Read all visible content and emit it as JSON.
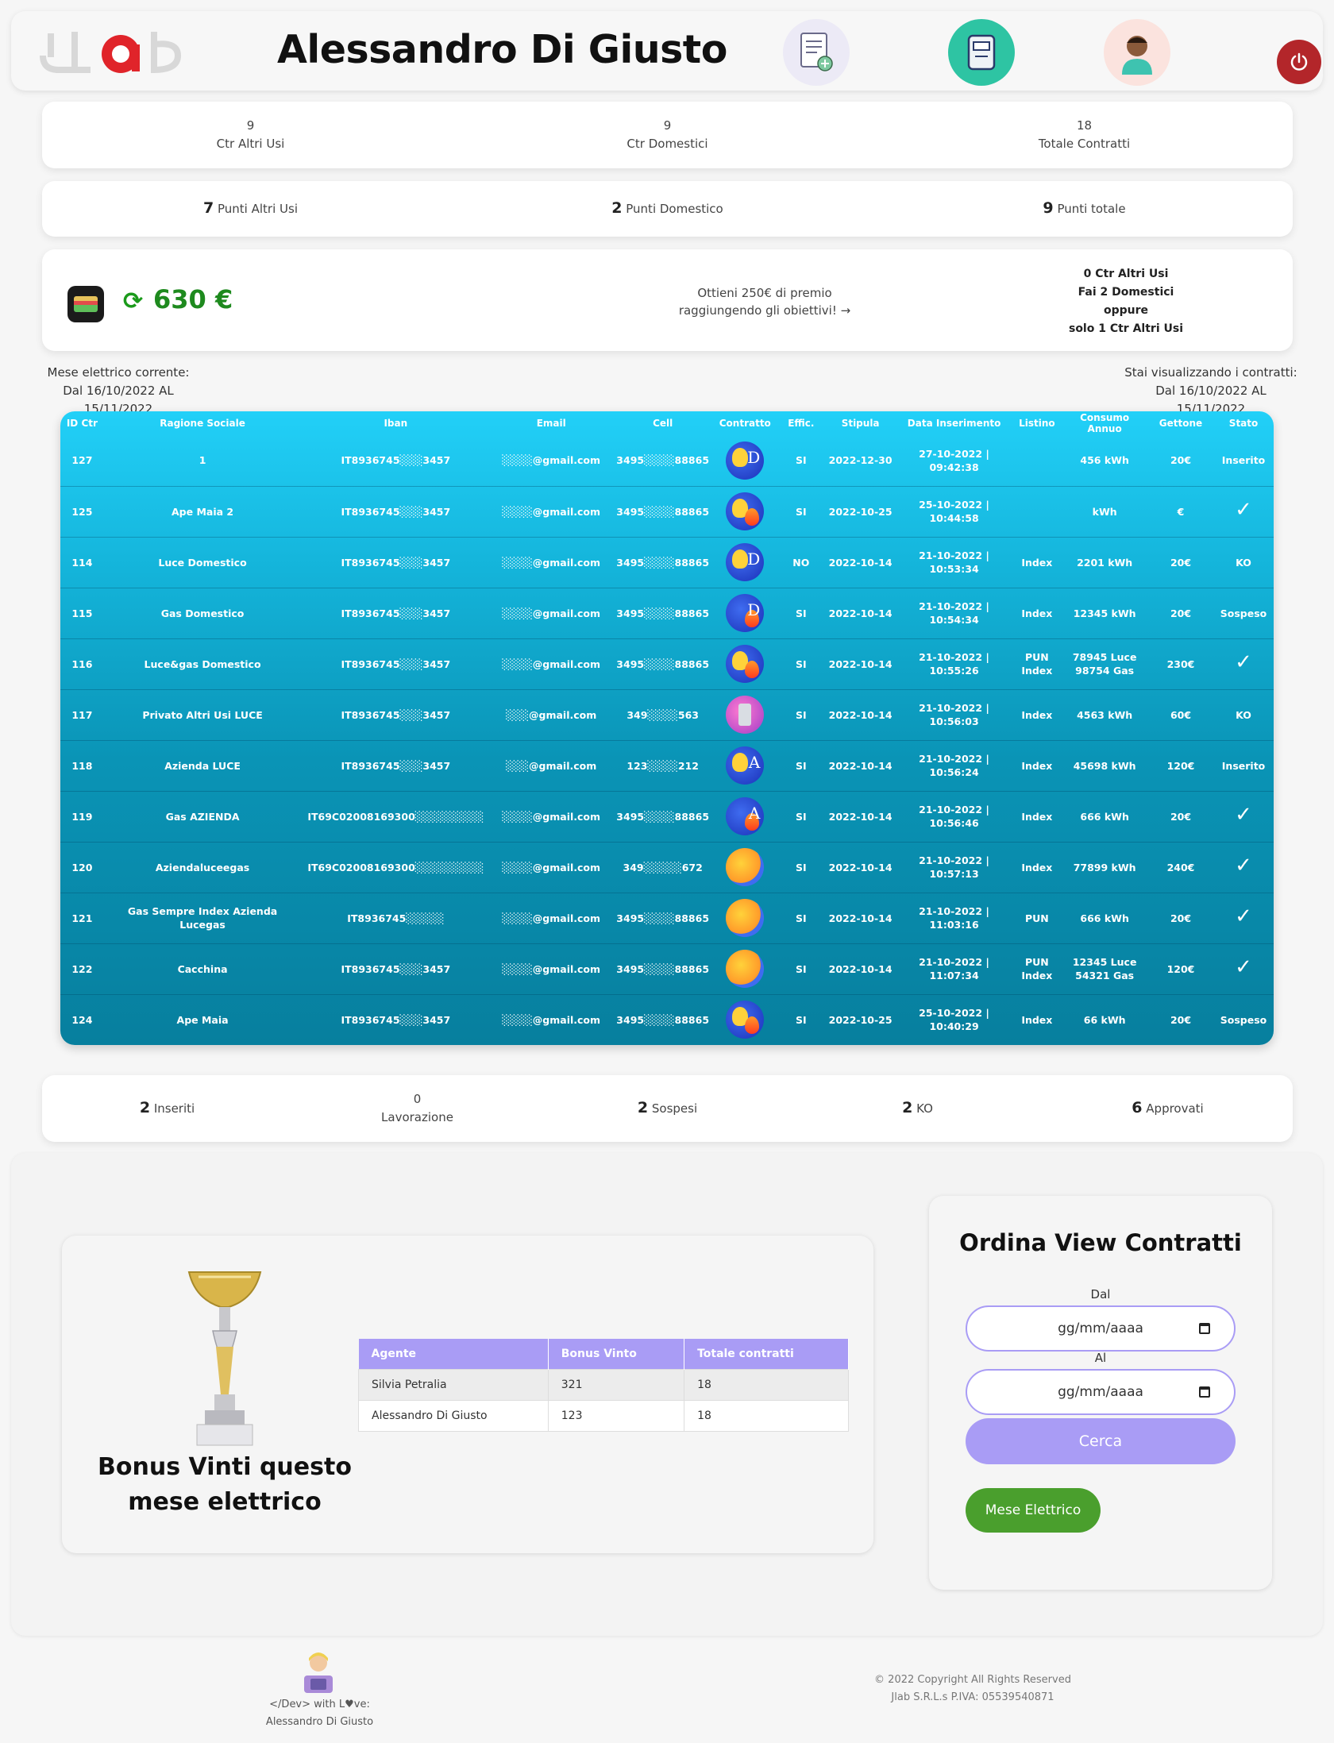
{
  "header": {
    "logo_text": "JLab",
    "agent_name": "Alessandro Di Giusto"
  },
  "counts": {
    "altri_usi_value": "9",
    "altri_usi_label": "Ctr Altri Usi",
    "domestici_value": "9",
    "domestici_label": "Ctr Domestici",
    "totale_value": "18",
    "totale_label": "Totale Contratti"
  },
  "points": {
    "altri_usi_value": "7",
    "altri_usi_label": "Punti Altri Usi",
    "domestico_value": "2",
    "domestico_label": "Punti Domestico",
    "totale_value": "9",
    "totale_label": "Punti totale"
  },
  "wallet": {
    "amount": "630 €",
    "promo_line1": "Ottieni 250€ di premio",
    "promo_line2": "raggiungendo gli obiettivi! →",
    "goal_1": "0 Ctr Altri Usi",
    "goal_2": "Fai 2 Domestici",
    "goal_3": "oppure",
    "goal_4": "solo 1 Ctr Altri Usi"
  },
  "period": {
    "left_line1": "Mese elettrico corrente:",
    "left_line2": "Dal 16/10/2022 AL 15/11/2022",
    "right_line1": "Stai visualizzando i contratti:",
    "right_line2": "Dal 16/10/2022 AL 15/11/2022"
  },
  "contracts": {
    "columns": [
      "ID Ctr",
      "Ragione Sociale",
      "Iban",
      "Email",
      "Cell",
      "Contratto",
      "Effic.",
      "Stipula",
      "Data Inserimento",
      "Listino",
      "Consumo Annuo",
      "Gettone",
      "Stato"
    ],
    "rows": [
      {
        "id": "127",
        "ragione": "1",
        "iban": "IT8936745░░░3457",
        "email": "░░░░@gmail.com",
        "cell": "3495░░░░88865",
        "contratto": "luce-D",
        "effic": "SI",
        "stipula": "2022-12-30",
        "data": "27-10-2022 | 09:42:38",
        "listino": "",
        "consumo": "456 kWh",
        "gettone": "20€",
        "stato": "Inserito"
      },
      {
        "id": "125",
        "ragione": "Ape Maia 2",
        "iban": "IT8936745░░░3457",
        "email": "░░░░@gmail.com",
        "cell": "3495░░░░88865",
        "contratto": "dual",
        "effic": "SI",
        "stipula": "2022-10-25",
        "data": "25-10-2022 | 10:44:58",
        "listino": "",
        "consumo": "kWh",
        "gettone": "€",
        "stato": "✓"
      },
      {
        "id": "114",
        "ragione": "Luce Domestico",
        "iban": "IT8936745░░░3457",
        "email": "░░░░@gmail.com",
        "cell": "3495░░░░88865",
        "contratto": "luce-D",
        "effic": "NO",
        "stipula": "2022-10-14",
        "data": "21-10-2022 | 10:53:34",
        "listino": "Index",
        "consumo": "2201 kWh",
        "gettone": "20€",
        "stato": "KO"
      },
      {
        "id": "115",
        "ragione": "Gas Domestico",
        "iban": "IT8936745░░░3457",
        "email": "░░░░@gmail.com",
        "cell": "3495░░░░88865",
        "contratto": "gas-D",
        "effic": "SI",
        "stipula": "2022-10-14",
        "data": "21-10-2022 | 10:54:34",
        "listino": "Index",
        "consumo": "12345 kWh",
        "gettone": "20€",
        "stato": "Sospeso"
      },
      {
        "id": "116",
        "ragione": "Luce&gas Domestico",
        "iban": "IT8936745░░░3457",
        "email": "░░░░@gmail.com",
        "cell": "3495░░░░88865",
        "contratto": "dual",
        "effic": "SI",
        "stipula": "2022-10-14",
        "data": "21-10-2022 | 10:55:26",
        "listino": "PUN\nIndex",
        "consumo": "78945 Luce\n98754 Gas",
        "gettone": "230€",
        "stato": "✓"
      },
      {
        "id": "117",
        "ragione": "Privato Altri Usi LUCE",
        "iban": "IT8936745░░░3457",
        "email": "░░░@gmail.com",
        "cell": "349░░░░563",
        "contratto": "meter",
        "effic": "SI",
        "stipula": "2022-10-14",
        "data": "21-10-2022 | 10:56:03",
        "listino": "Index",
        "consumo": "4563 kWh",
        "gettone": "60€",
        "stato": "KO"
      },
      {
        "id": "118",
        "ragione": "Azienda LUCE",
        "iban": "IT8936745░░░3457",
        "email": "░░░@gmail.com",
        "cell": "123░░░░212",
        "contratto": "luce-A",
        "effic": "SI",
        "stipula": "2022-10-14",
        "data": "21-10-2022 | 10:56:24",
        "listino": "Index",
        "consumo": "45698 kWh",
        "gettone": "120€",
        "stato": "Inserito"
      },
      {
        "id": "119",
        "ragione": "Gas AZIENDA",
        "iban": "IT69C02008169300░░░░░░░░░",
        "email": "░░░░@gmail.com",
        "cell": "3495░░░░88865",
        "contratto": "gas-A",
        "effic": "SI",
        "stipula": "2022-10-14",
        "data": "21-10-2022 | 10:56:46",
        "listino": "Index",
        "consumo": "666 kWh",
        "gettone": "20€",
        "stato": "✓"
      },
      {
        "id": "120",
        "ragione": "Aziendaluceegas",
        "iban": "IT69C02008169300░░░░░░░░░",
        "email": "░░░░@gmail.com",
        "cell": "349░░░░░672",
        "contratto": "sun",
        "effic": "SI",
        "stipula": "2022-10-14",
        "data": "21-10-2022 | 10:57:13",
        "listino": "Index",
        "consumo": "77899 kWh",
        "gettone": "240€",
        "stato": "✓"
      },
      {
        "id": "121",
        "ragione": "Gas Sempre Index Azienda Lucegas",
        "iban": "IT8936745░░░░░",
        "email": "░░░░@gmail.com",
        "cell": "3495░░░░88865",
        "contratto": "sun",
        "effic": "SI",
        "stipula": "2022-10-14",
        "data": "21-10-2022 | 11:03:16",
        "listino": "PUN",
        "consumo": "666 kWh",
        "gettone": "20€",
        "stato": "✓"
      },
      {
        "id": "122",
        "ragione": "Cacchina",
        "iban": "IT8936745░░░3457",
        "email": "░░░░@gmail.com",
        "cell": "3495░░░░88865",
        "contratto": "sun",
        "effic": "SI",
        "stipula": "2022-10-14",
        "data": "21-10-2022 | 11:07:34",
        "listino": "PUN\nIndex",
        "consumo": "12345 Luce\n54321 Gas",
        "gettone": "120€",
        "stato": "✓"
      },
      {
        "id": "124",
        "ragione": "Ape Maia",
        "iban": "IT8936745░░░3457",
        "email": "░░░░@gmail.com",
        "cell": "3495░░░░88865",
        "contratto": "dual",
        "effic": "SI",
        "stipula": "2022-10-25",
        "data": "25-10-2022 | 10:40:29",
        "listino": "Index",
        "consumo": "66 kWh",
        "gettone": "20€",
        "stato": "Sospeso"
      }
    ]
  },
  "status_summary": {
    "inseriti_value": "2",
    "inseriti_label": "Inseriti",
    "lavorazione_value": "0",
    "lavorazione_label": "Lavorazione",
    "sospesi_value": "2",
    "sospesi_label": "Sospesi",
    "ko_value": "2",
    "ko_label": "KO",
    "approvati_value": "6",
    "approvati_label": "Approvati"
  },
  "bonus": {
    "title": "Bonus Vinti questo mese elettrico",
    "columns": [
      "Agente",
      "Bonus Vinto",
      "Totale contratti"
    ],
    "rows": [
      [
        "Silvia Petralia",
        "321",
        "18"
      ],
      [
        "Alessandro Di Giusto",
        "123",
        "18"
      ]
    ]
  },
  "sort": {
    "title": "Ordina View Contratti",
    "from_label": "Dal",
    "from_placeholder": "gg/mm/aaaa",
    "to_label": "Al",
    "to_placeholder": "gg/mm/aaaa",
    "search_button": "Cerca",
    "month_button": "Mese Elettrico"
  },
  "footer": {
    "dev_line1": "</Dev> with L♥ve:",
    "dev_line2": "Alessandro Di Giusto",
    "copyright_line1": "© 2022 Copyright All Rights Reserved",
    "copyright_line2": "Jlab S.R.L.s  P.IVA: 05539540871"
  },
  "colors": {
    "accent_purple": "#a99cf5",
    "table_top": "#22d0f8",
    "table_bottom": "#077f9e",
    "money_green": "#1e8a1e",
    "power_red": "#b3262a",
    "month_button_green": "#4a9f2d"
  }
}
